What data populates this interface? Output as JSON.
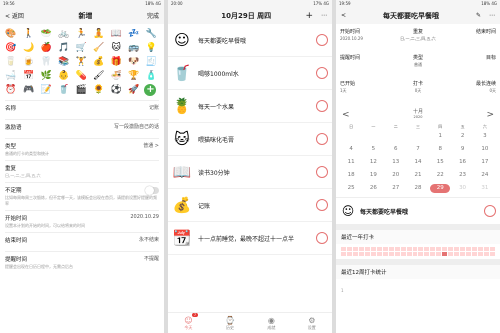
{
  "p1": {
    "status": {
      "time": "19:56",
      "right": "18% 4G"
    },
    "back": "< 返回",
    "title": "新增",
    "done": "完成",
    "emojis": [
      "🎨",
      "🚶",
      "🥗",
      "🚲",
      "🏃",
      "🧘",
      "📖",
      "💤",
      "🔧",
      "🎯",
      "🌙",
      "🍎",
      "🎵",
      "🛒",
      "🧹",
      "🐱",
      "🚌",
      "💡",
      "🥛",
      "🍺",
      "🦷",
      "📚",
      "🏋",
      "💰",
      "🎁",
      "🐶",
      "🧾",
      "🛁",
      "📅",
      "🌿",
      "👶",
      "💊",
      "🖌",
      "🍜",
      "🏆",
      "🧴",
      "⏰",
      "🎮",
      "📝",
      "🥤",
      "🎬",
      "🌻",
      "⚽",
      "🚀"
    ],
    "add_label": "+",
    "fields": [
      {
        "label": "名称",
        "value": "记账",
        "sub": ""
      },
      {
        "label": "激励语",
        "value": "写一段激励自己的话",
        "sub": ""
      },
      {
        "label": "类型",
        "value": "普通 >",
        "sub": "普通的打卡的类型和统计"
      },
      {
        "label": "重复",
        "value": "",
        "sub": "日,一,二,三,四,五,六"
      },
      {
        "label": "不定期",
        "value": "",
        "sub": "比如每周每周三次锻炼，但不定哪一天，该模板会出现在首页，请提前设置好提醒的频率"
      },
      {
        "label": "开始时间",
        "value": "2020.10.29",
        "sub": "设置本计划的开始的时间，可以给将来的时间"
      },
      {
        "label": "结束时间",
        "value": "永不结束",
        "sub": ""
      },
      {
        "label": "提醒时间",
        "value": "不提醒",
        "sub": "提醒会出现在日历日程中，无需点后台"
      }
    ]
  },
  "p2": {
    "status": {
      "time": "20:00",
      "right": "17% 4G"
    },
    "title": "10月29日 周四",
    "tasks": [
      {
        "icon": "☺",
        "name": "每天都要吃早餐哦"
      },
      {
        "icon": "🥤",
        "name": "喝够1000ml水"
      },
      {
        "icon": "🍍",
        "name": "每天一个水果"
      },
      {
        "icon": "🐱",
        "name": "喂猫咪化毛膏"
      },
      {
        "icon": "📖",
        "name": "读书30分钟"
      },
      {
        "icon": "💰",
        "name": "记账"
      },
      {
        "icon": "📆",
        "name": "十一点前睡觉，最晚不超过十一点半"
      }
    ],
    "tabs": [
      {
        "icon": "☺",
        "label": "今天",
        "badge": "7"
      },
      {
        "icon": "⌚",
        "label": "历史",
        "badge": ""
      },
      {
        "icon": "◉",
        "label": "成就",
        "badge": ""
      },
      {
        "icon": "⚙",
        "label": "设置",
        "badge": ""
      }
    ]
  },
  "p3": {
    "status": {
      "time": "19:59",
      "right": "18% 4G"
    },
    "title": "每天都要吃早餐哦",
    "info": [
      {
        "k": "开始时间",
        "v": "2020.10.29"
      },
      {
        "k": "重复",
        "v": "日,一,二,三,四,五,六"
      },
      {
        "k": "结束时间",
        "v": ""
      },
      {
        "k": "提醒时间",
        "v": ""
      },
      {
        "k": "类型",
        "v": "普通"
      },
      {
        "k": "目标",
        "v": ""
      },
      {
        "k": "已开始",
        "v": "1天"
      },
      {
        "k": "打卡",
        "v": "0天"
      },
      {
        "k": "最长连续",
        "v": "0天"
      }
    ],
    "month": "十月",
    "year": "2020",
    "weekdays": [
      "日",
      "一",
      "二",
      "三",
      "四",
      "五",
      "六"
    ],
    "weeks": [
      [
        "",
        "",
        "",
        "",
        "1",
        "2",
        "3"
      ],
      [
        "4",
        "5",
        "6",
        "7",
        "8",
        "9",
        "10"
      ],
      [
        "11",
        "12",
        "13",
        "14",
        "15",
        "16",
        "17"
      ],
      [
        "18",
        "19",
        "20",
        "21",
        "22",
        "23",
        "24"
      ],
      [
        "25",
        "26",
        "27",
        "28",
        "29",
        "30",
        "31"
      ]
    ],
    "today": "29",
    "task_name": "每天都要吃早餐哦",
    "section1": "最近一年打卡",
    "section2": "最近12周打卡统计",
    "ylabel": "1"
  }
}
